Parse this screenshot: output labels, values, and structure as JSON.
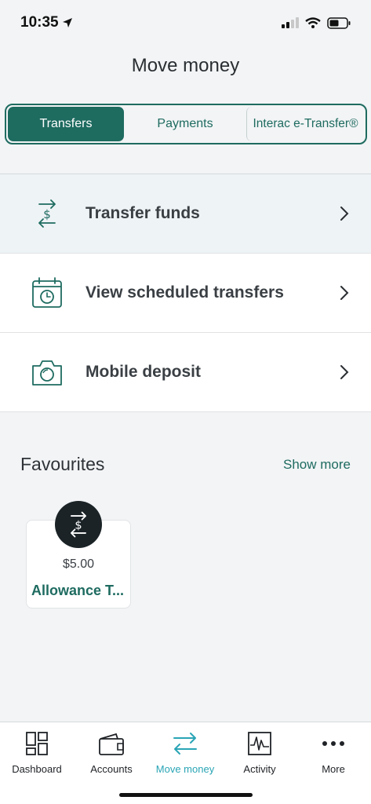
{
  "status": {
    "time": "10:35"
  },
  "header": {
    "title": "Move money"
  },
  "segments": [
    {
      "label": "Transfers",
      "active": true
    },
    {
      "label": "Payments",
      "active": false
    },
    {
      "label": "Interac e-Transfer®",
      "active": false
    }
  ],
  "list": [
    {
      "label": "Transfer funds",
      "icon": "transfer-dollar-icon"
    },
    {
      "label": "View scheduled transfers",
      "icon": "calendar-clock-icon"
    },
    {
      "label": "Mobile deposit",
      "icon": "camera-icon"
    }
  ],
  "favourites": {
    "title": "Favourites",
    "show_more": "Show more",
    "items": [
      {
        "amount": "$5.00",
        "name": "Allowance T..."
      }
    ]
  },
  "tabbar": [
    {
      "label": "Dashboard",
      "icon": "dashboard-grid-icon"
    },
    {
      "label": "Accounts",
      "icon": "wallet-icon"
    },
    {
      "label": "Move money",
      "icon": "transfer-arrows-icon",
      "active": true
    },
    {
      "label": "Activity",
      "icon": "activity-chart-icon"
    },
    {
      "label": "More",
      "icon": "more-dots-icon"
    }
  ],
  "colors": {
    "accent": "#1e6b60",
    "active_tab": "#2aa5b5",
    "badge_bg": "#1b2327"
  }
}
